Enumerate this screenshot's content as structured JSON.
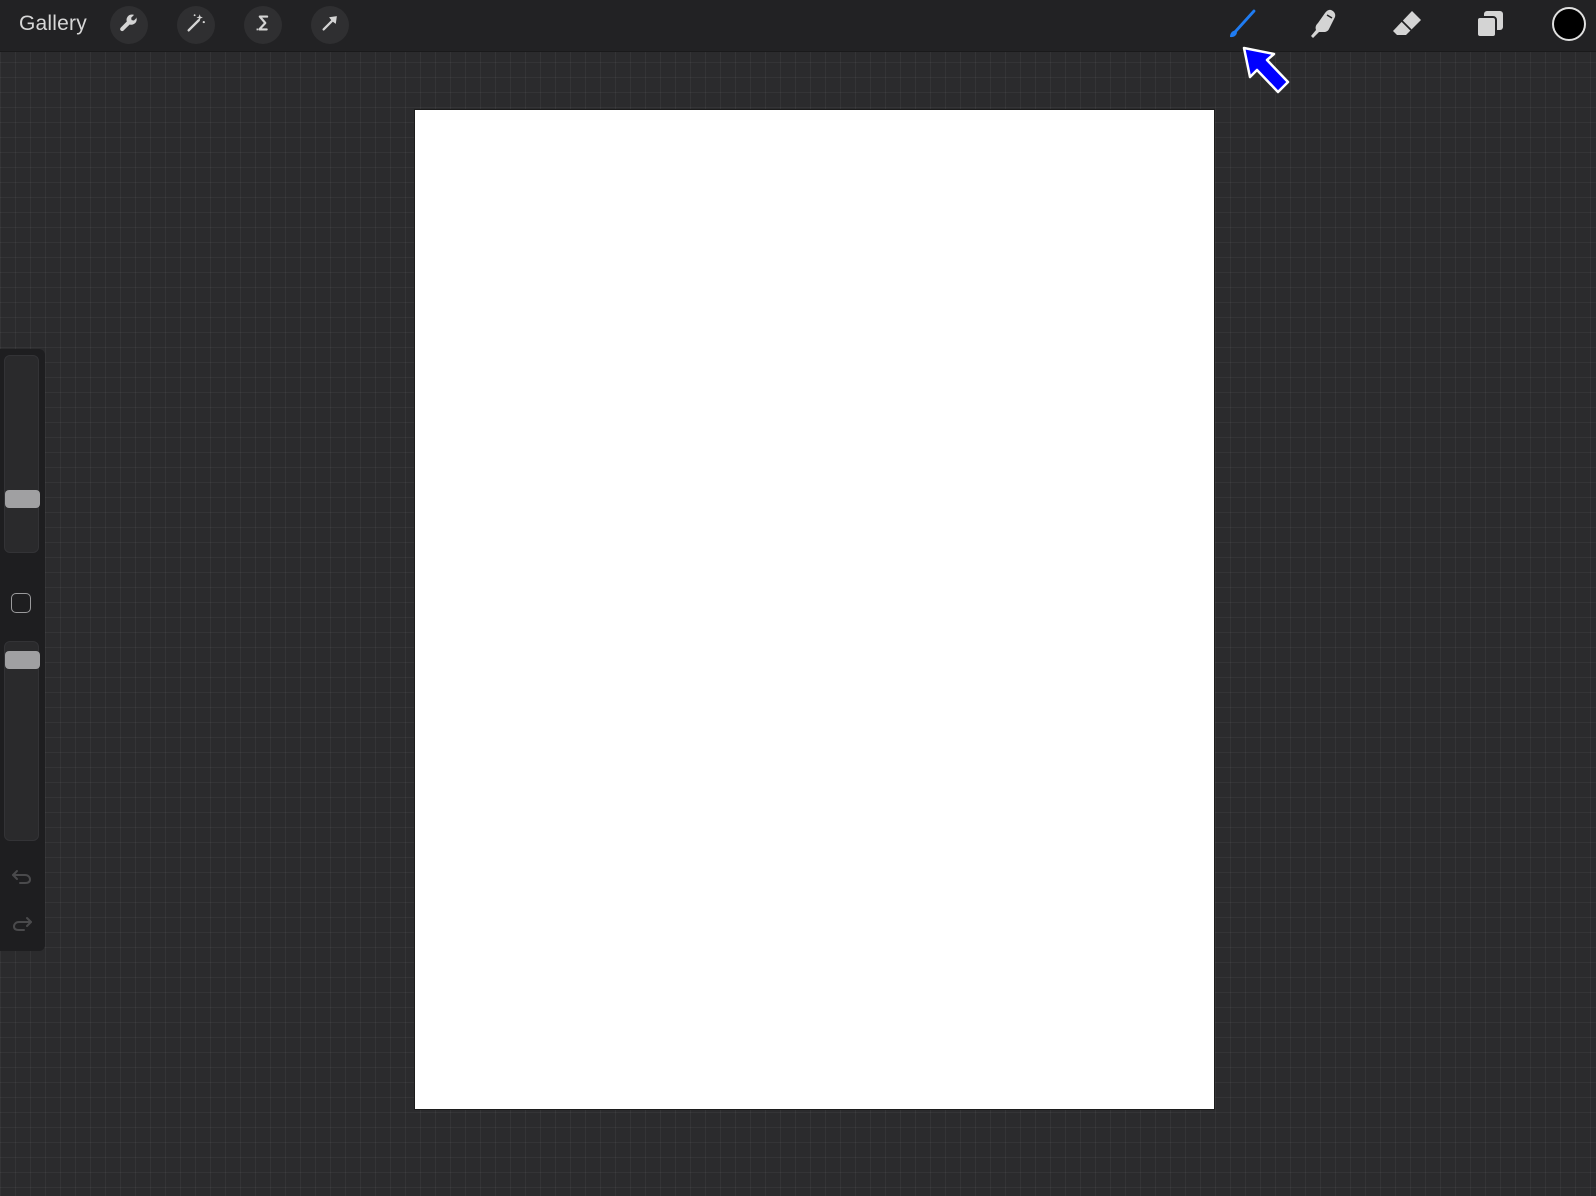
{
  "app": {
    "gallery_label": "Gallery"
  },
  "toolbar_left": [
    {
      "name": "actions-button",
      "icon": "wrench-icon"
    },
    {
      "name": "adjustments-button",
      "icon": "magic-wand-icon"
    },
    {
      "name": "selection-button",
      "icon": "selection-s-icon"
    },
    {
      "name": "transform-button",
      "icon": "transform-arrow-icon"
    }
  ],
  "toolbar_right": [
    {
      "name": "brush-tool",
      "icon": "paintbrush-icon",
      "active": true
    },
    {
      "name": "smudge-tool",
      "icon": "smudge-finger-icon",
      "active": false
    },
    {
      "name": "eraser-tool",
      "icon": "eraser-icon",
      "active": false
    },
    {
      "name": "layers-button",
      "icon": "layers-icon",
      "active": false
    },
    {
      "name": "color-button",
      "icon": "color-swatch-circle",
      "active": false
    }
  ],
  "colors": {
    "active_tool": "#1f7cf2",
    "current_color": "#000000",
    "annotation_arrow": "#0000ff",
    "canvas": "#ffffff"
  },
  "sidebar": {
    "brush_size_level": 0.25,
    "opacity_level": 0.95
  }
}
